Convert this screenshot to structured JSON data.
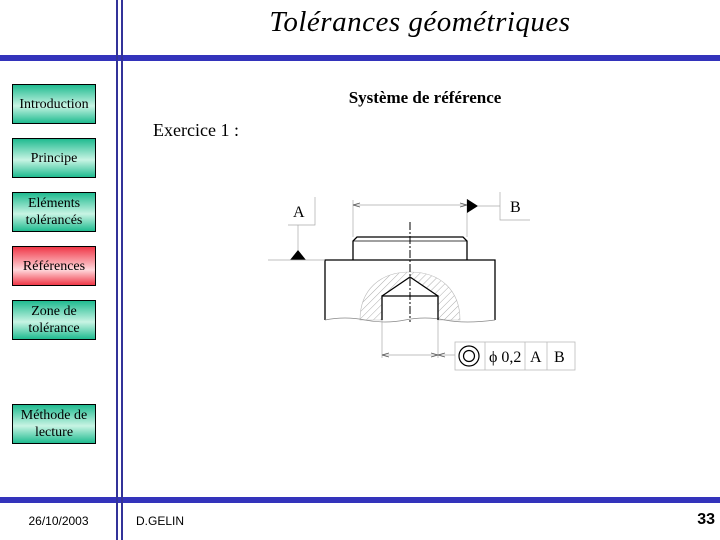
{
  "header": {
    "title": "Tolérances géométriques"
  },
  "nav": {
    "items": [
      {
        "label": "Introduction",
        "active": false
      },
      {
        "label": "Principe",
        "active": false
      },
      {
        "label": "Eléments tolérancés",
        "active": false
      },
      {
        "label": "Références",
        "active": true
      },
      {
        "label": "Zone de tolérance",
        "active": false
      },
      {
        "label": "Méthode de lecture",
        "active": false
      }
    ]
  },
  "main": {
    "subtitle": "Système de référence",
    "exercise": "Exercice 1 :",
    "drawing": {
      "datum_a": "A",
      "datum_b": "B",
      "tolerance_frame": {
        "symbol": "concentricity-icon",
        "value": "ϕ 0,2",
        "ref1": "A",
        "ref2": "B"
      }
    }
  },
  "footer": {
    "date": "26/10/2003",
    "author": "D.GELIN",
    "page": "33"
  },
  "colors": {
    "bar": "#3333bb",
    "nav_inactive": "#20bb90",
    "nav_active": "#f03848"
  }
}
